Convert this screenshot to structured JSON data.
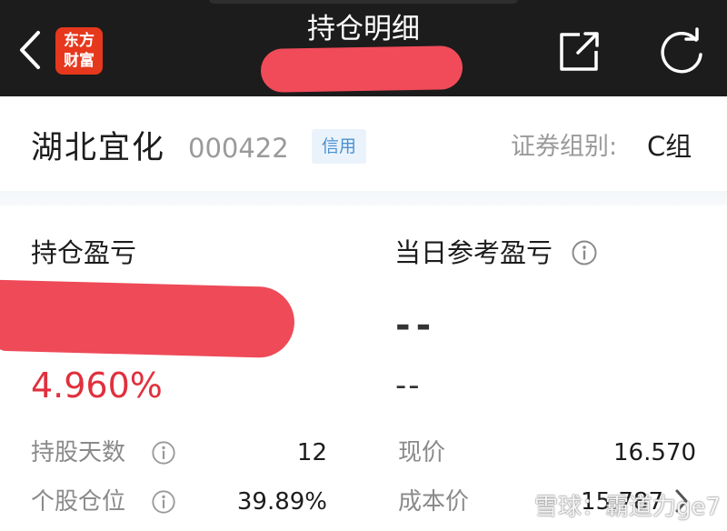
{
  "header": {
    "title": "持仓明细",
    "logo_text": "东方财富",
    "icons": [
      "back-icon",
      "external-share-icon",
      "refresh-icon"
    ]
  },
  "stock": {
    "name": "湖北宜化",
    "code": "000422",
    "account_type": "信用",
    "group_label": "证券组别:",
    "group_value": "C组"
  },
  "profit": {
    "holding_pl_label": "持仓盈亏",
    "holding_pl_percent": "4.960%",
    "today_pl_label": "当日参考盈亏",
    "today_pl_value": "--",
    "today_pl_percent": "--"
  },
  "details": {
    "hold_days_label": "持股天数",
    "hold_days_value": "12",
    "position_label": "个股仓位",
    "position_value": "39.89%",
    "price_label": "现价",
    "price_value": "16.570",
    "cost_label": "成本价",
    "cost_value": "15.787"
  },
  "watermark": "雪球：霸道力ge7",
  "colors": {
    "header_bg": "#1c1c1c",
    "logo_red": "#e6381d",
    "profit_red": "#e0303d",
    "badge_blue": "#4a90d0",
    "redaction": "#ee4a58"
  }
}
